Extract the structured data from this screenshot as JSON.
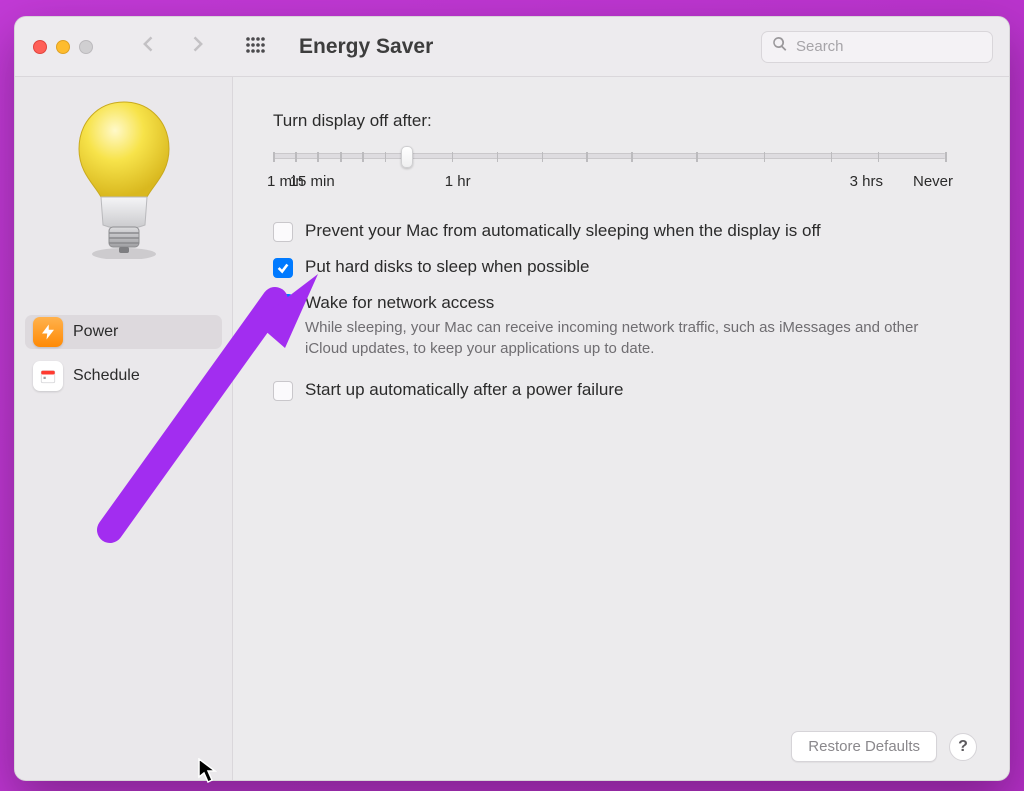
{
  "toolbar": {
    "title": "Energy Saver",
    "search_placeholder": "Search"
  },
  "sidebar": {
    "items": [
      {
        "label": "Power",
        "selected": true
      },
      {
        "label": "Schedule",
        "selected": false
      }
    ]
  },
  "slider": {
    "label": "Turn display off after:",
    "ticks": [
      "1 min",
      "15 min",
      "1 hr",
      "3 hrs",
      "Never"
    ],
    "knob_position_pct": 20.5
  },
  "options": [
    {
      "label": "Prevent your Mac from automatically sleeping when the display is off",
      "checked": false
    },
    {
      "label": "Put hard disks to sleep when possible",
      "checked": true
    },
    {
      "label": "Wake for network access",
      "checked": true,
      "sub": "While sleeping, your Mac can receive incoming network traffic, such as iMessages and other iCloud updates, to keep your applications up to date."
    },
    {
      "label": "Start up automatically after a power failure",
      "checked": false
    }
  ],
  "footer": {
    "restore_label": "Restore Defaults",
    "help_label": "?"
  }
}
